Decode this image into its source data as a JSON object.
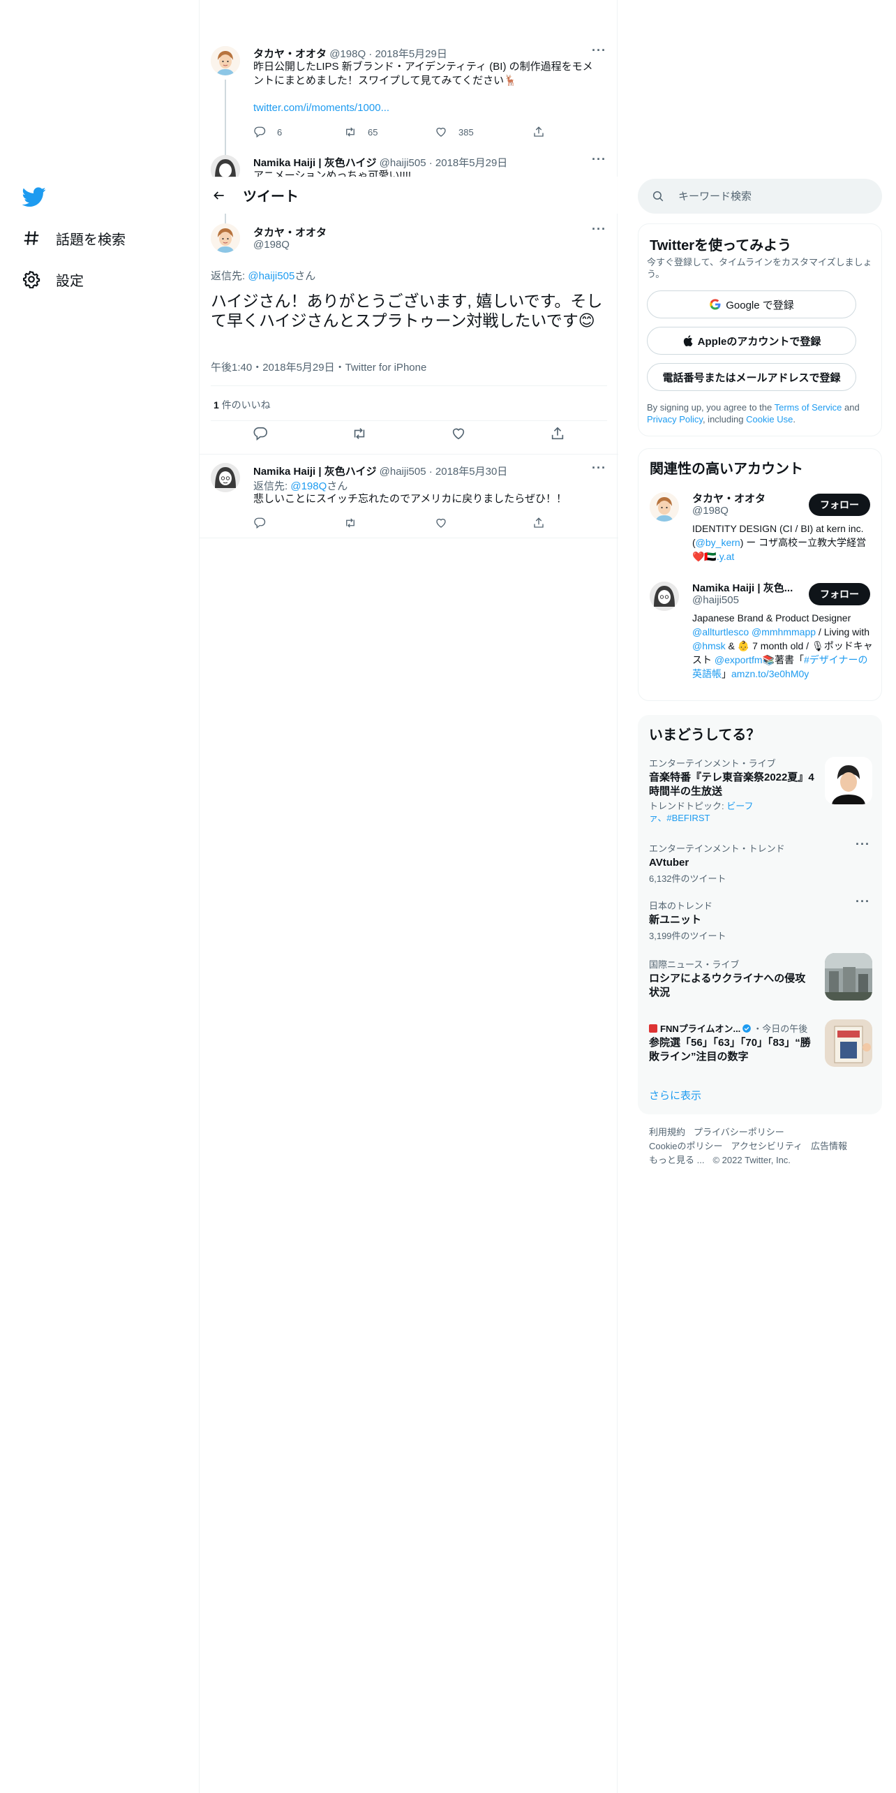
{
  "nav": {
    "items": [
      {
        "label": "話題を検索",
        "icon": "hashtag-icon"
      },
      {
        "label": "設定",
        "icon": "gear-icon"
      }
    ]
  },
  "thread": {
    "tweet1": {
      "name": "タカヤ・オオタ",
      "handle": "@198Q",
      "date": "2018年5月29日",
      "text": "昨日公開したLIPS 新ブランド・アイデンティティ (BI) の制作過程をモメントにまとめました！スワイプして見てみてください",
      "link": "twitter.com/i/moments/1000...",
      "replies": "6",
      "retweets": "65",
      "likes": "385"
    },
    "tweet2": {
      "name": "Namika Haiji | 灰色ハイジ",
      "handle": "@haiji505",
      "date": "2018年5月29日",
      "text": "アニメーションめっちゃ可愛い!!!!"
    }
  },
  "header": {
    "title": "ツイート"
  },
  "focus": {
    "name": "タカヤ・オオタ",
    "handle": "@198Q",
    "reply_prefix": "返信先: ",
    "reply_to": "@haiji505",
    "reply_suffix": "さん",
    "text": "ハイジさん！ありがとうございます, 嬉しいです。そして早くハイジさんとスプラトゥーン対戦したいです",
    "meta": "午後1:40・2018年5月29日・Twitter for iPhone",
    "likes_count": "1",
    "likes_label": "件のいいね"
  },
  "reply": {
    "name": "Namika Haiji | 灰色ハイジ",
    "handle": "@haiji505",
    "date": "2018年5月30日",
    "reply_prefix": "返信先: ",
    "reply_to": "@198Q",
    "reply_suffix": "さん",
    "text": "悲しいことにスイッチ忘れたのでアメリカに戻りましたらぜひ！！"
  },
  "sidebar": {
    "search_placeholder": "キーワード検索",
    "signup": {
      "title": "Twitterを使ってみよう",
      "desc": "今すぐ登録して、タイムラインをカスタマイズしましょう。",
      "google": "Google で登録",
      "apple": "Appleのアカウントで登録",
      "phone": "電話番号またはメールアドレスで登録",
      "legal_1": "By signing up, you agree to the ",
      "terms": "Terms of Service",
      "legal_2": " and ",
      "privacy": "Privacy Policy",
      "legal_3": ", including ",
      "cookie": "Cookie Use",
      "legal_4": "."
    },
    "related": {
      "title": "関連性の高いアカウント",
      "accounts": [
        {
          "name": "タカヤ・オオタ",
          "handle": "@198Q",
          "follow": "フォロー",
          "bio_1": "IDENTITY DESIGN (CI / BI) at kern inc. (",
          "bio_link1": "@by_kern",
          "bio_2": ") ー コザ高校ー立教大学経営 ",
          "bio_link2": "❤️🇦🇪.y.at"
        },
        {
          "name": "Namika Haiji | 灰色...",
          "handle": "@haiji505",
          "follow": "フォロー",
          "bio_1": "Japanese Brand & Product Designer ",
          "bio_link1": "@allturtlesco @mmhmmapp",
          "bio_2": " / Living with ",
          "bio_link2": "@hmsk",
          "bio_3": " & 👶 7 month old / 🎙ポッドキャスト ",
          "bio_link3": "@exportfm",
          "bio_4": "📚著書「",
          "bio_link4": "#デザイナーの英語帳",
          "bio_5": "」",
          "bio_link5": "amzn.to/3e0hM0y"
        }
      ]
    },
    "trends": {
      "title": "いまどうしてる？",
      "items": [
        {
          "context": "エンターテインメント・ライブ",
          "title": "音楽特番『テレ東音楽祭2022夏』4時間半の生放送",
          "sub_prefix": "トレンドトピック: ",
          "sub_links": "ビーファ、#BEFIRST"
        },
        {
          "context": "エンターテインメント・トレンド",
          "title": "AVtuber",
          "sub": "6,132件のツイート"
        },
        {
          "context": "日本のトレンド",
          "title": "新ユニット",
          "sub": "3,199件のツイート"
        },
        {
          "context": "国際ニュース・ライブ",
          "title": "ロシアによるウクライナへの侵攻状況"
        },
        {
          "context_source": "FNNプライムオン...",
          "context_time": "・今日の午後",
          "title": "参院選「56」「63」「70」「83」“勝敗ライン”注目の数字"
        }
      ],
      "show_more": "さらに表示"
    },
    "footer": [
      "利用規約",
      "プライバシーポリシー",
      "Cookieのポリシー",
      "アクセシビリティ",
      "広告情報",
      "もっと見る ...",
      "© 2022 Twitter, Inc."
    ]
  },
  "colors": {
    "accent": "#1d9bf0",
    "text": "#0f1419",
    "muted": "#536471",
    "border": "#eff3f4"
  }
}
